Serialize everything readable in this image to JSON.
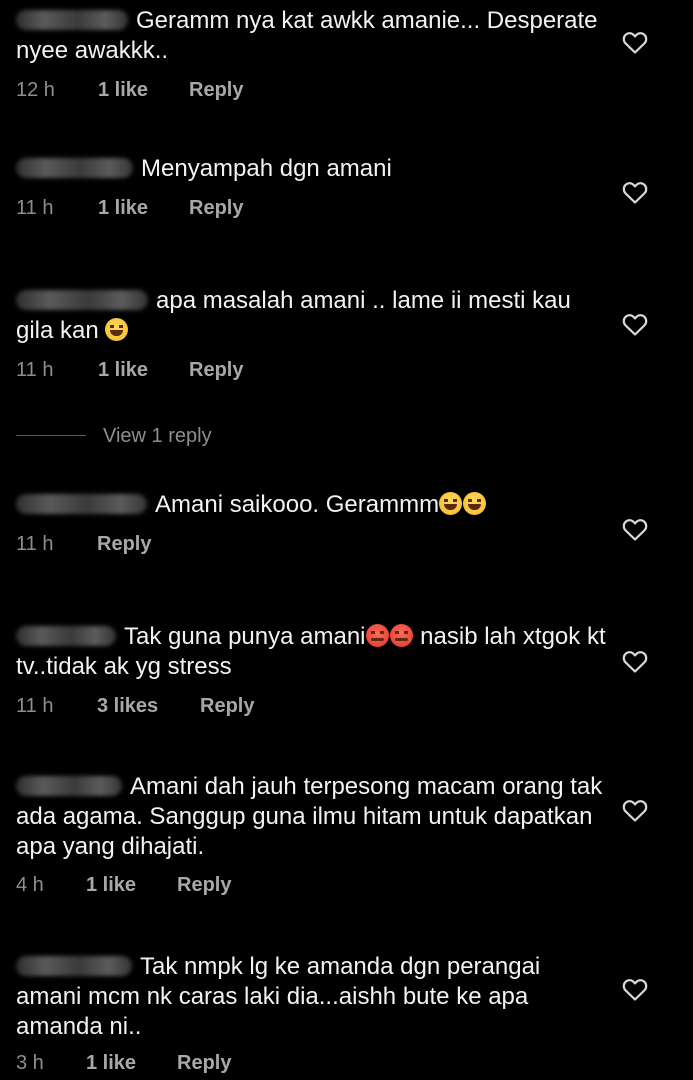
{
  "comments": [
    {
      "text": "Geramm nya kat awkk amanie... Desperate nyee awakkk..",
      "time": "12 h",
      "likes": "1 like",
      "reply": "Reply"
    },
    {
      "text": "Menyampah dgn amani",
      "time": "11 h",
      "likes": "1 like",
      "reply": "Reply"
    },
    {
      "text": "apa masalah amani .. lame ii mesti kau gila kan",
      "time": "11 h",
      "likes": "1 like",
      "reply": "Reply",
      "view_replies": "View 1 reply"
    },
    {
      "text": "Amani saikooo. Gerammm",
      "time": "11 h",
      "reply": "Reply"
    },
    {
      "text_part1": "Tak guna punya amani",
      "text_part2": "nasib lah xtgok kt tv..tidak ak yg stress",
      "time": "11 h",
      "likes": "3 likes",
      "reply": "Reply"
    },
    {
      "text": "Amani dah jauh terpesong macam orang tak ada agama. Sanggup guna ilmu  hitam untuk dapatkan apa yang dihajati.",
      "time": "4 h",
      "likes": "1 like",
      "reply": "Reply"
    },
    {
      "text": "Tak nmpk lg ke amanda dgn perangai amani mcm nk caras laki dia...aishh bute ke apa amanda ni..",
      "time": "3 h",
      "likes": "1 like",
      "reply": "Reply"
    }
  ],
  "icons": {
    "heart": "heart-outline-icon",
    "emoji_laugh": "face-with-tears-of-joy-icon",
    "emoji_angry": "angry-face-icon",
    "emoji_grin": "grinning-face-with-sweat-icon"
  },
  "colors": {
    "background": "#000000",
    "text": "#f2f2f2",
    "meta": "#8e8e8e"
  }
}
